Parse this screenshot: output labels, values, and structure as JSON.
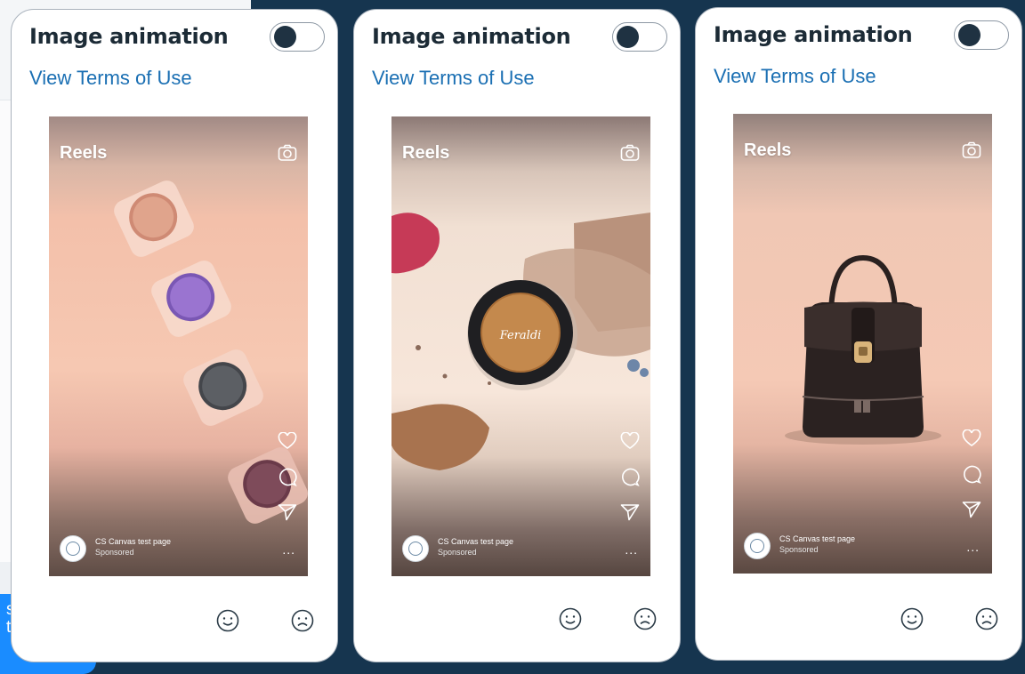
{
  "background_side": {
    "chat_bubble_lines": [
      "s",
      "tipos"
    ]
  },
  "cards": [
    {
      "title": "Image animation",
      "toggle_on": false,
      "terms_link": "View Terms of Use",
      "preview": {
        "label": "Reels",
        "page_name": "CS Canvas test page",
        "sponsored": "Sponsored",
        "more": "...",
        "image": "eyeshadow-jars"
      }
    },
    {
      "title": "Image animation",
      "toggle_on": false,
      "terms_link": "View Terms of Use",
      "preview": {
        "label": "Reels",
        "page_name": "CS Canvas test page",
        "sponsored": "Sponsored",
        "more": "...",
        "image": "eyeshadow-compact",
        "brand": "Feraldi"
      }
    },
    {
      "title": "Image animation",
      "toggle_on": false,
      "terms_link": "View Terms of Use",
      "preview": {
        "label": "Reels",
        "page_name": "CS Canvas test page",
        "sponsored": "Sponsored",
        "more": "...",
        "image": "leather-backpack"
      }
    }
  ],
  "icons": {
    "camera": "camera-icon",
    "like": "heart-icon",
    "comment": "comment-icon",
    "share": "send-icon",
    "rate_good": "smile-icon",
    "rate_bad": "frown-icon"
  },
  "colors": {
    "page_bg": "#16354f",
    "link": "#1a6fb3",
    "chat_bubble": "#1a8cff",
    "toggle_knob": "#1f3242"
  }
}
